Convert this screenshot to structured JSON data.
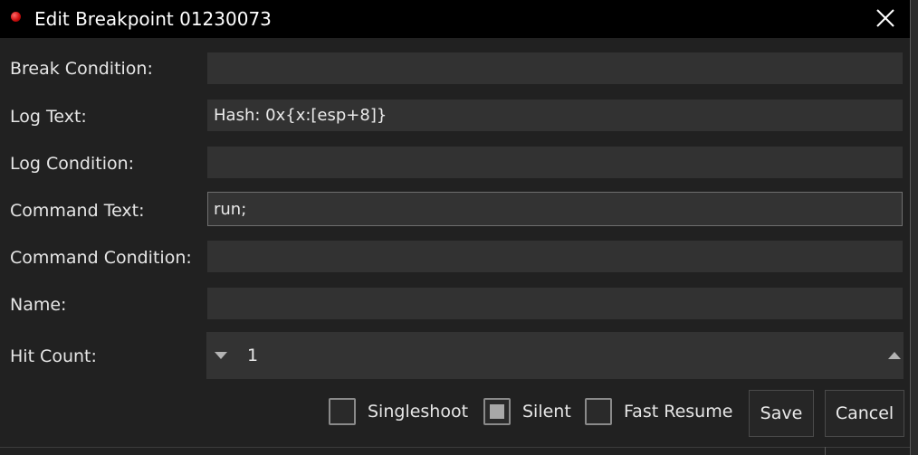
{
  "window": {
    "title": "Edit Breakpoint 01230073",
    "close_icon": "close-icon",
    "status_icon": "red-dot-icon"
  },
  "form": {
    "break_condition": {
      "label": "Break Condition:",
      "value": ""
    },
    "log_text": {
      "label": "Log Text:",
      "value": "Hash: 0x{x:[esp+8]}"
    },
    "log_condition": {
      "label": "Log Condition:",
      "value": ""
    },
    "command_text": {
      "label": "Command Text:",
      "value": "run;"
    },
    "command_condition": {
      "label": "Command Condition:",
      "value": ""
    },
    "name": {
      "label": "Name:",
      "value": ""
    },
    "hit_count": {
      "label": "Hit Count:",
      "value": "1"
    }
  },
  "options": {
    "singleshoot": {
      "label": "Singleshoot",
      "checked": false
    },
    "silent": {
      "label": "Silent",
      "checked": true
    },
    "fast_resume": {
      "label": "Fast Resume",
      "checked": false
    }
  },
  "buttons": {
    "save": "Save",
    "cancel": "Cancel"
  },
  "colors": {
    "titlebar": "#000000",
    "background": "#212121",
    "field": "#323232",
    "text": "#e6e6e6",
    "status_dot": "#d01010"
  }
}
